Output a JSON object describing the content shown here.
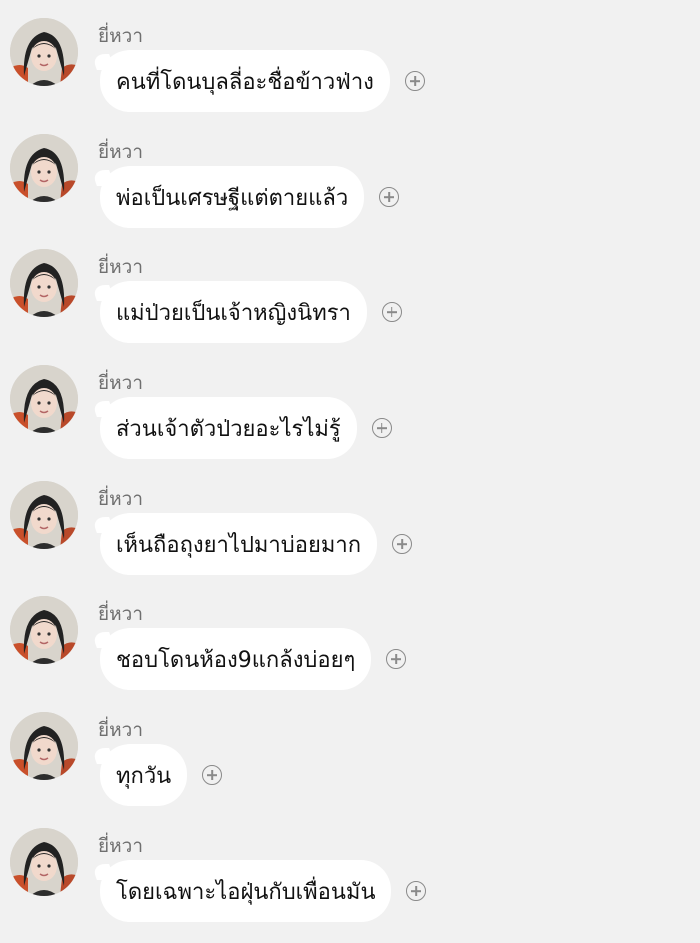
{
  "sender_name": "ยี่หวา",
  "messages": [
    {
      "text": "คนที่โดนบุลลี่อะชื่อข้าวฟ่าง"
    },
    {
      "text": "พ่อเป็นเศรษฐีแต่ตายแล้ว"
    },
    {
      "text": "แม่ป่วยเป็นเจ้าหญิงนิทรา"
    },
    {
      "text": "ส่วนเจ้าตัวป่วยอะไรไม่รู้"
    },
    {
      "text": "เห็นถือถุงยาไปมาบ่อยมาก"
    },
    {
      "text": "ชอบโดนห้อง9แกล้งบ่อยๆ"
    },
    {
      "text": "ทุกวัน"
    },
    {
      "text": "โดยเฉพาะไอฝุ่นกับเพื่อนมัน"
    }
  ],
  "icons": {
    "avatar": "avatar-photo-icon",
    "add_reaction": "plus-circle-icon"
  }
}
